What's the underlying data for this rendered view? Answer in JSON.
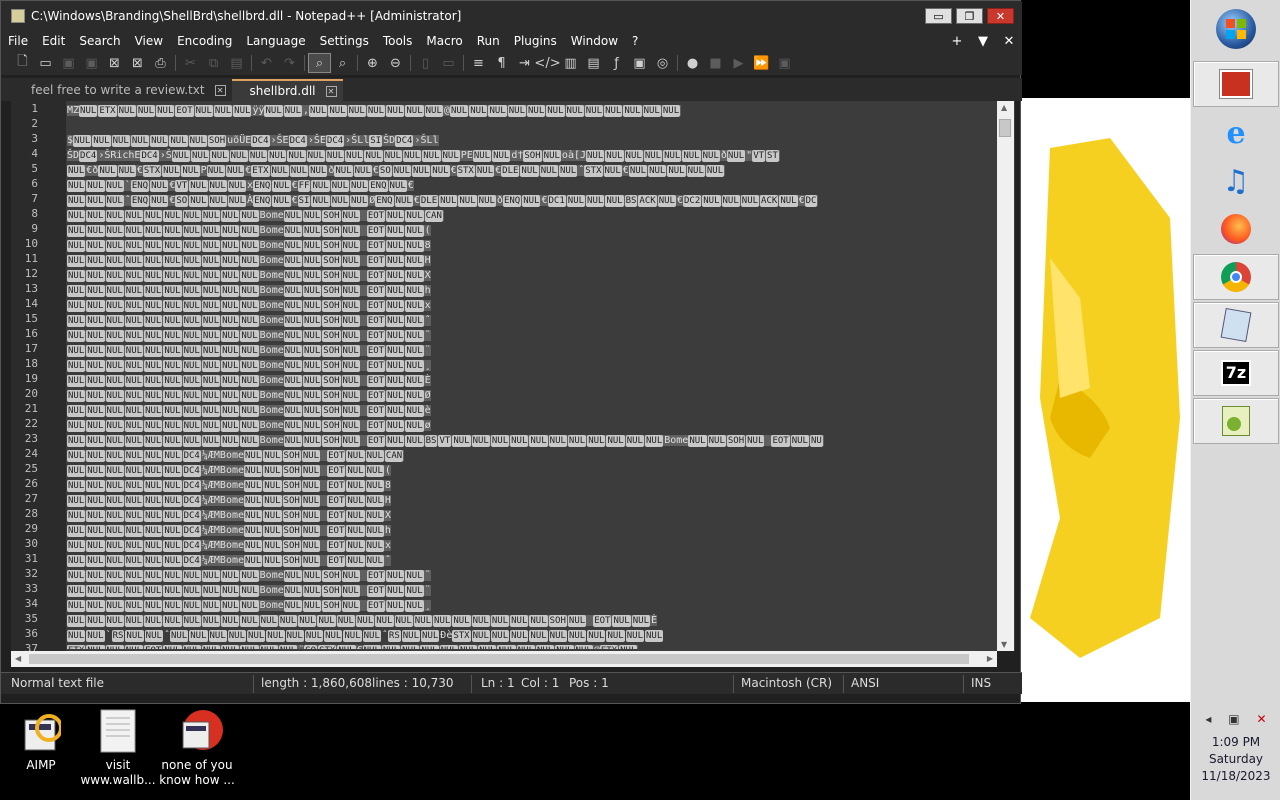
{
  "window": {
    "title": "C:\\Windows\\Branding\\ShellBrd\\shellbrd.dll - Notepad++ [Administrator]",
    "controls": {
      "minimize": "▭",
      "restore": "❐",
      "close": "✕"
    }
  },
  "menu": {
    "items": [
      "File",
      "Edit",
      "Search",
      "View",
      "Encoding",
      "Language",
      "Settings",
      "Tools",
      "Macro",
      "Run",
      "Plugins",
      "Window",
      "?"
    ],
    "right": [
      "+",
      "▼",
      "✕"
    ]
  },
  "tabs": [
    {
      "label": "feel free to write a review.txt",
      "active": false
    },
    {
      "label": "shellbrd.dll",
      "active": true
    }
  ],
  "editor": {
    "line_numbers": [
      "1",
      "2",
      "3",
      "4",
      "5",
      "6",
      "7",
      "8",
      "9",
      "10",
      "11",
      "12",
      "13",
      "14",
      "15",
      "16",
      "17",
      "18",
      "19",
      "20",
      "21",
      "22",
      "23",
      "24",
      "25",
      "26",
      "27",
      "28",
      "29",
      "30",
      "31",
      "32",
      "33",
      "34",
      "35",
      "36",
      "37"
    ],
    "lines": [
      "MZ NUL ETX NUL NUL NUL EOT NUL NUL NUL ÿÿ NUL NUL , NUL NUL NUL NUL NUL NUL NUL @ NUL NUL NUL NUL NUL NUL NUL NUL NUL NUL NUL NUL",
      "",
      "$ NUL NUL NUL NUL NUL NUL NUL SOH uõÜE DC4 ›ŠE DC4 ›ŠE DC4 ›ŠLl SI ŠD DC4 ›ŠLl",
      "ŠD DC4 ›ŠRichE DC4 ›Š NUL NUL NUL NUL NUL NUL NUL NUL NUL NUL NUL NUL NUL NUL NUL PE NUL NUL d† SOH NUL oà[J NUL NUL NUL NUL NUL NUL NUL ð NUL \" VT ST",
      "NUL €ð NUL NUL € STX NUL NUL P NUL NUL € ETX NUL NUL NUL ð NUL NUL € SO NUL NUL NUL € STX NUL € DLE NUL NUL NUL ˆ STX NUL € NUL NUL NUL NUL NUL",
      "NUL NUL NUL ` ENQ NUL € VT NUL NUL NUL x ENQ NUL € FF NUL NUL NUL ENQ NUL €",
      "NUL NUL NUL ˆ ENQ NUL € SO NUL NUL NUL À ENQ NUL € SI NUL NUL NUL Ø ENQ NUL € DLE NUL NUL NUL ð ENQ NUL € DC1 NUL NUL NUL BS ACK NUL € DC2 NUL NUL NUL ACK NUL € DC",
      "NUL NUL NUL NUL NUL NUL NUL NUL NUL NUL Bome NUL NUL SOH NUL     EOT NUL NUL CAN",
      "NUL NUL NUL NUL NUL NUL NUL NUL NUL NUL Bome NUL NUL SOH NUL     EOT NUL NUL (",
      "NUL NUL NUL NUL NUL NUL NUL NUL NUL NUL Bome NUL NUL SOH NUL     EOT NUL NUL 8",
      "NUL NUL NUL NUL NUL NUL NUL NUL NUL NUL Bome NUL NUL SOH NUL     EOT NUL NUL H",
      "NUL NUL NUL NUL NUL NUL NUL NUL NUL NUL Bome NUL NUL SOH NUL     EOT NUL NUL X",
      "NUL NUL NUL NUL NUL NUL NUL NUL NUL NUL Bome NUL NUL SOH NUL     EOT NUL NUL h",
      "NUL NUL NUL NUL NUL NUL NUL NUL NUL NUL Bome NUL NUL SOH NUL     EOT NUL NUL x",
      "NUL NUL NUL NUL NUL NUL NUL NUL NUL NUL Bome NUL NUL SOH NUL     EOT NUL NUL ˆ",
      "NUL NUL NUL NUL NUL NUL NUL NUL NUL NUL Bome NUL NUL SOH NUL     EOT NUL NUL ˜",
      "NUL NUL NUL NUL NUL NUL NUL NUL NUL NUL Bome NUL NUL SOH NUL     EOT NUL NUL ¨",
      "NUL NUL NUL NUL NUL NUL NUL NUL NUL NUL Bome NUL NUL SOH NUL     EOT NUL NUL ¸",
      "NUL NUL NUL NUL NUL NUL NUL NUL NUL NUL Bome NUL NUL SOH NUL     EOT NUL NUL È",
      "NUL NUL NUL NUL NUL NUL NUL NUL NUL NUL Bome NUL NUL SOH NUL     EOT NUL NUL Ø",
      "NUL NUL NUL NUL NUL NUL NUL NUL NUL NUL Bome NUL NUL SOH NUL     EOT NUL NUL è",
      "NUL NUL NUL NUL NUL NUL NUL NUL NUL NUL Bome NUL NUL SOH NUL     EOT NUL NUL ø",
      "NUL NUL NUL NUL NUL NUL NUL NUL NUL NUL Bome NUL NUL SOH NUL     EOT NUL NUL BS VT NUL NUL NUL NUL NUL NUL NUL NUL NUL NUL NUL Bome NUL NUL SOH NUL   EOT NUL NU",
      "NUL NUL NUL NUL NUL NUL DC4 ¼ÆMBome NUL NUL SOH NUL     EOT NUL NUL CAN",
      "NUL NUL NUL NUL NUL NUL DC4 ¼ÆMBome NUL NUL SOH NUL     EOT NUL NUL (",
      "NUL NUL NUL NUL NUL NUL DC4 ¼ÆMBome NUL NUL SOH NUL     EOT NUL NUL 8",
      "NUL NUL NUL NUL NUL NUL DC4 ¼ÆMBome NUL NUL SOH NUL     EOT NUL NUL H",
      "NUL NUL NUL NUL NUL NUL DC4 ¼ÆMBome NUL NUL SOH NUL     EOT NUL NUL X",
      "NUL NUL NUL NUL NUL NUL DC4 ¼ÆMBome NUL NUL SOH NUL     EOT NUL NUL h",
      "NUL NUL NUL NUL NUL NUL DC4 ¼ÆMBome NUL NUL SOH NUL     EOT NUL NUL x",
      "NUL NUL NUL NUL NUL NUL DC4 ¼ÆMBome NUL NUL SOH NUL     EOT NUL NUL ˆ",
      "NUL NUL NUL NUL NUL NUL NUL NUL NUL NUL Bome NUL NUL SOH NUL     EOT NUL NUL ˜",
      "NUL NUL NUL NUL NUL NUL NUL NUL NUL NUL Bome NUL NUL SOH NUL     EOT NUL NUL ¨",
      "NUL NUL NUL NUL NUL NUL NUL NUL NUL NUL Bome NUL NUL SOH NUL     EOT NUL NUL ¸",
      "NUL NUL NUL NUL NUL NUL NUL NUL NUL NUL NUL NUL NUL NUL NUL NUL NUL NUL NUL NUL NUL NUL NUL NUL NUL SOH NUL   EOT NUL NUL È",
      "NUL NUL ` RS NUL NUL ˆ NUL NUL NUL NUL NUL NUL NUL NUL NUL NUL NUL ˆ RS NUL NUL Ðè STX NUL NUL NUL NUL NUL NUL NUL NUL NUL NUL",
      "ETX NUL NUL NUL EOT NUL NUL NUL NUL NUL NUL NUL ¨ SO STX NUL € NUL NUL NUL NUL NUL NUL NUL NUL NUL NUL NUL NUL @ ETX NUL"
    ]
  },
  "status": {
    "file_type": "Normal text file",
    "length": "length : 1,860,608",
    "lines": "lines : 10,730",
    "ln": "Ln : 1",
    "col": "Col : 1",
    "pos": "Pos : 1",
    "eol": "Macintosh (CR)",
    "encoding": "ANSI",
    "mode": "INS"
  },
  "desktop_icons": [
    {
      "label": "AIMP"
    },
    {
      "label": "visit www.wallb..."
    },
    {
      "label": "none of you know how ..."
    }
  ],
  "taskbar": {
    "buttons": [
      "start-orb",
      "media-center",
      "internet-explorer",
      "music",
      "firefox",
      "chrome",
      "notepad",
      "7zip",
      "notepadplusplus"
    ],
    "zip_label": "7z",
    "time": "1:09 PM",
    "day": "Saturday",
    "date": "11/18/2023"
  },
  "colors": {
    "editor_bg": "#3c3c3c",
    "selection": "#606060",
    "wallpaper_yellow": "#f5d020",
    "close_button": "#c8382c"
  }
}
